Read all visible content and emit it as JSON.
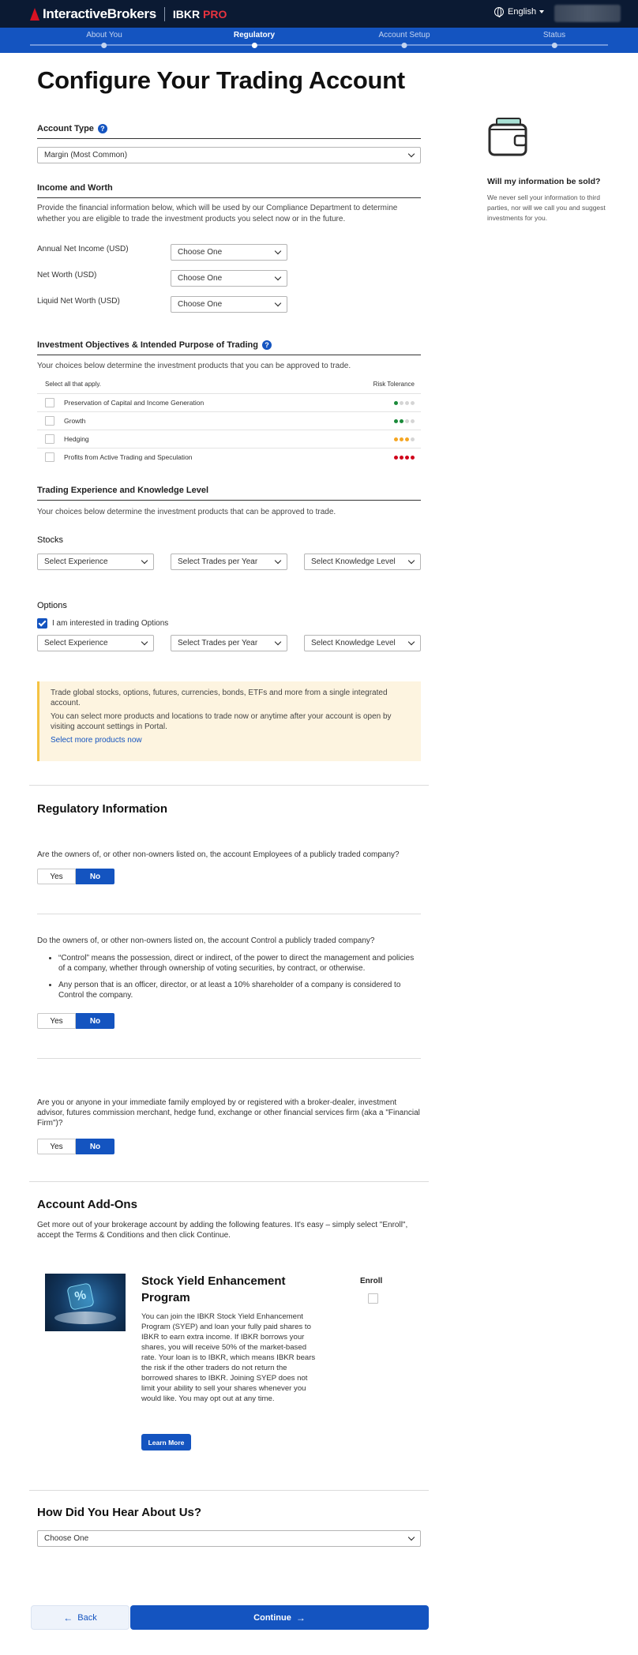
{
  "header": {
    "brand": "InteractiveBrokers",
    "product": "IBKR",
    "product_suffix": "PRO",
    "language": "English"
  },
  "progress": {
    "steps": [
      {
        "label": "About You",
        "active": false
      },
      {
        "label": "Regulatory",
        "active": true
      },
      {
        "label": "Account Setup",
        "active": false
      },
      {
        "label": "Status",
        "active": false
      }
    ]
  },
  "page": {
    "title": "Configure Your Trading Account"
  },
  "account_type": {
    "heading": "Account Type",
    "selected": "Margin (Most Common)"
  },
  "income": {
    "heading": "Income and Worth",
    "description": "Provide the financial information below, which will be used by our Compliance Department to determine whether you are eligible to trade the investment products you select now or in the future.",
    "fields": [
      {
        "label": "Annual Net Income (USD)",
        "value": "Choose One"
      },
      {
        "label": "Net Worth (USD)",
        "value": "Choose One"
      },
      {
        "label": "Liquid Net Worth (USD)",
        "value": "Choose One"
      }
    ]
  },
  "objectives": {
    "heading": "Investment Objectives & Intended Purpose of Trading",
    "description": "Your choices below determine the investment products that you can be approved to trade.",
    "select_all": "Select all that apply.",
    "risk_label": "Risk Tolerance",
    "rows": [
      {
        "label": "Preservation of Capital and Income Generation",
        "risk": 1,
        "color": "#1b8a3a"
      },
      {
        "label": "Growth",
        "risk": 2,
        "color": "#1b8a3a"
      },
      {
        "label": "Hedging",
        "risk": 3,
        "color": "#f5a623"
      },
      {
        "label": "Profits from Active Trading and Speculation",
        "risk": 4,
        "color": "#d0021b"
      }
    ]
  },
  "experience": {
    "heading": "Trading Experience and Knowledge Level",
    "description": "Your choices below determine the investment products that can be approved to trade.",
    "stocks_label": "Stocks",
    "options_label": "Options",
    "options_checkbox": "I am interested in trading Options",
    "exp_placeholder": "Select Experience",
    "trades_placeholder": "Select Trades per Year",
    "knowledge_placeholder": "Select Knowledge Level"
  },
  "notice": {
    "line1": "Trade global stocks, options, futures, currencies, bonds, ETFs and more from a single integrated account.",
    "line2": "You can select more products and locations to trade now or anytime after your account is open by visiting account settings in Portal.",
    "link": "Select more products now"
  },
  "regulatory": {
    "heading": "Regulatory Information",
    "q1": "Are the owners of, or other non-owners listed on, the account Employees of a publicly traded company?",
    "q2": "Do the owners of, or other non-owners listed on, the account Control a publicly traded company?",
    "q2_bullets": [
      "“Control” means the possession, direct or indirect, of the power to direct the management and policies of a company, whether through ownership of voting securities, by contract, or otherwise.",
      "Any person that is an officer, director, or at least a 10% shareholder of a company is considered to Control the company."
    ],
    "q3": "Are you or anyone in your immediate family employed by or registered with a broker-dealer, investment advisor, futures commission merchant, hedge fund, exchange or other financial services firm (aka a \"Financial Firm\")?",
    "yes": "Yes",
    "no": "No"
  },
  "addons": {
    "heading": "Account Add-Ons",
    "description": "Get more out of your brokerage account by adding the following features. It's easy – simply select \"Enroll\", accept the Terms & Conditions and then click Continue.",
    "card_title": "Stock Yield Enhancement Program",
    "card_desc": "You can join the IBKR Stock Yield Enhancement Program (SYEP) and loan your fully paid shares to IBKR to earn extra income. If IBKR borrows your shares, you will receive 50% of the market-based rate. Your loan is to IBKR, which means IBKR bears the risk if the other traders do not return the borrowed shares to IBKR. Joining SYEP does not limit your ability to sell your shares whenever you would like. You may opt out at any time.",
    "learn_more": "Learn More",
    "enroll": "Enroll",
    "img_glyph": "%"
  },
  "hear": {
    "heading": "How Did You Hear About Us?",
    "value": "Choose One"
  },
  "nav": {
    "back": "Back",
    "continue": "Continue"
  },
  "sidebar": {
    "title": "Will my information be sold?",
    "text": "We never sell your information to third parties, nor will we call you and suggest investments for you."
  }
}
